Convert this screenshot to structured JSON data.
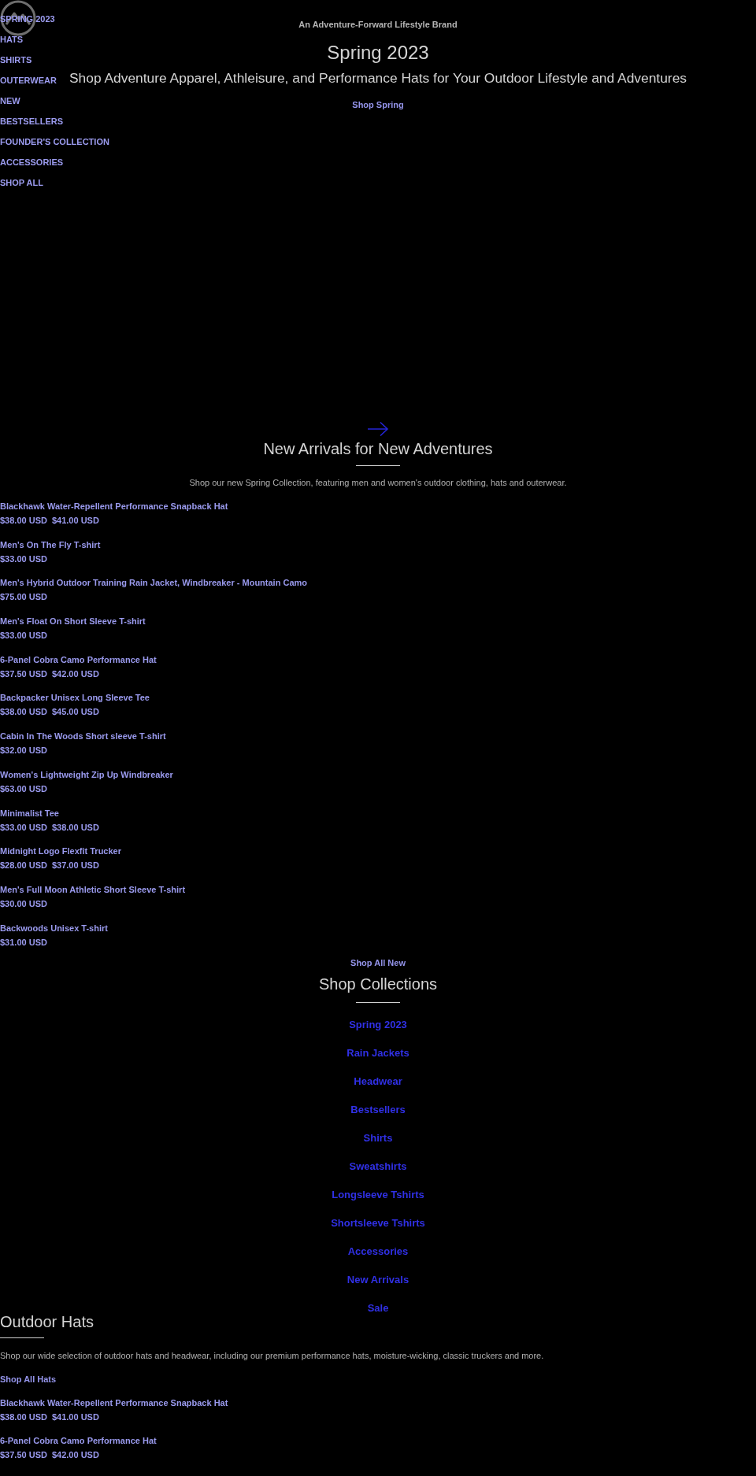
{
  "header": {
    "nav": [
      "SPRING 2023",
      "HATS",
      "SHIRTS",
      "OUTERWEAR",
      "NEW",
      "BESTSELLERS",
      "FOUNDER'S COLLECTION",
      "ACCESSORIES",
      "SHOP ALL"
    ]
  },
  "hero": {
    "tagline": "An Adventure-Forward Lifestyle Brand",
    "title": "Spring 2023",
    "subtitle": "Shop Adventure Apparel, Athleisure, and Performance Hats for Your Outdoor Lifestyle and Adventures",
    "link": "Shop Spring"
  },
  "new_arrivals": {
    "title": "New Arrivals for New Adventures",
    "description": "Shop our new Spring Collection, featuring men and women's outdoor clothing, hats and outerwear.",
    "products": [
      {
        "name": "Blackhawk Water-Repellent Performance Snapback Hat",
        "price": "$38.00 USD",
        "compare_price": "$41.00 USD"
      },
      {
        "name": "Men's On The Fly T-shirt",
        "price": "$33.00 USD"
      },
      {
        "name": "Men's Hybrid Outdoor Training Rain Jacket, Windbreaker - Mountain Camo",
        "price": "$75.00 USD"
      },
      {
        "name": "Men's Float On Short Sleeve T-shirt",
        "price": "$33.00 USD"
      },
      {
        "name": "6-Panel Cobra Camo Performance Hat",
        "price": "$37.50 USD",
        "compare_price": "$42.00 USD"
      },
      {
        "name": "Backpacker Unisex Long Sleeve Tee",
        "price": "$38.00 USD",
        "compare_price": "$45.00 USD"
      },
      {
        "name": "Cabin In The Woods Short sleeve T-shirt",
        "price": "$32.00 USD"
      },
      {
        "name": "Women's Lightweight Zip Up Windbreaker",
        "price": "$63.00 USD"
      },
      {
        "name": "Minimalist Tee",
        "price": "$33.00 USD",
        "compare_price": "$38.00 USD"
      },
      {
        "name": "Midnight Logo Flexfit Trucker",
        "price": "$28.00 USD",
        "compare_price": "$37.00 USD"
      },
      {
        "name": "Men's Full Moon Athletic Short Sleeve T-shirt",
        "price": "$30.00 USD"
      },
      {
        "name": "Backwoods Unisex T-shirt",
        "price": "$31.00 USD"
      }
    ],
    "link": "Shop All New"
  },
  "collections": {
    "title": "Shop Collections",
    "links": [
      "Spring 2023",
      "Rain Jackets",
      "Headwear",
      "Bestsellers",
      "Shirts",
      "Sweatshirts",
      "Longsleeve Tshirts",
      "Shortsleeve Tshirts",
      "Accessories",
      "New Arrivals",
      "Sale"
    ]
  },
  "outdoor_hats": {
    "title": "Outdoor Hats",
    "description": "Shop our wide selection of outdoor hats and headwear, including our premium performance hats, moisture-wicking, classic truckers and more.",
    "link": "Shop All Hats",
    "products": [
      {
        "name": "Blackhawk Water-Repellent Performance Snapback Hat",
        "price": "$38.00 USD",
        "compare_price": "$41.00 USD"
      },
      {
        "name": "6-Panel Cobra Camo Performance Hat",
        "price": "$37.50 USD",
        "compare_price": "$42.00 USD"
      }
    ]
  }
}
